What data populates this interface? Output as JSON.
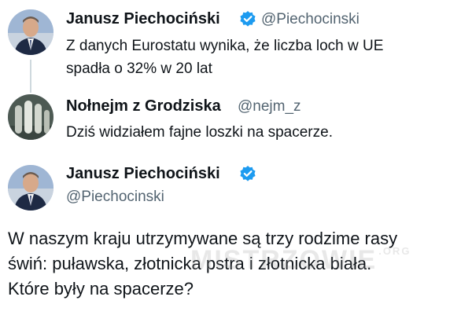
{
  "tweets": [
    {
      "author": "Janusz Piechociński",
      "handle": "@Piechocinski",
      "verified": true,
      "lines": [
        "Z danych Eurostatu wynika, że liczba loch w UE",
        "spadła o 32% w 20 lat"
      ]
    },
    {
      "author": "Nołnejm z Grodziska",
      "handle": "@nejm_z",
      "verified": false,
      "lines": [
        "Dziś widziałem fajne loszki na spacerze."
      ]
    }
  ],
  "main_tweet": {
    "author": "Janusz Piechociński",
    "handle": "@Piechocinski",
    "verified": true,
    "lines": [
      "W naszym kraju utrzymywane są trzy rodzime rasy",
      "świń: puławska, złotnicka pstra i złotnicka biała.",
      "Które były na spacerze?"
    ]
  },
  "watermark": {
    "text": "MISTRZOWIE",
    "suffix": ".ORG"
  },
  "colors": {
    "verified": "#1d9bf0",
    "secondary_text": "#536471",
    "thread_line": "#cfd9de"
  }
}
